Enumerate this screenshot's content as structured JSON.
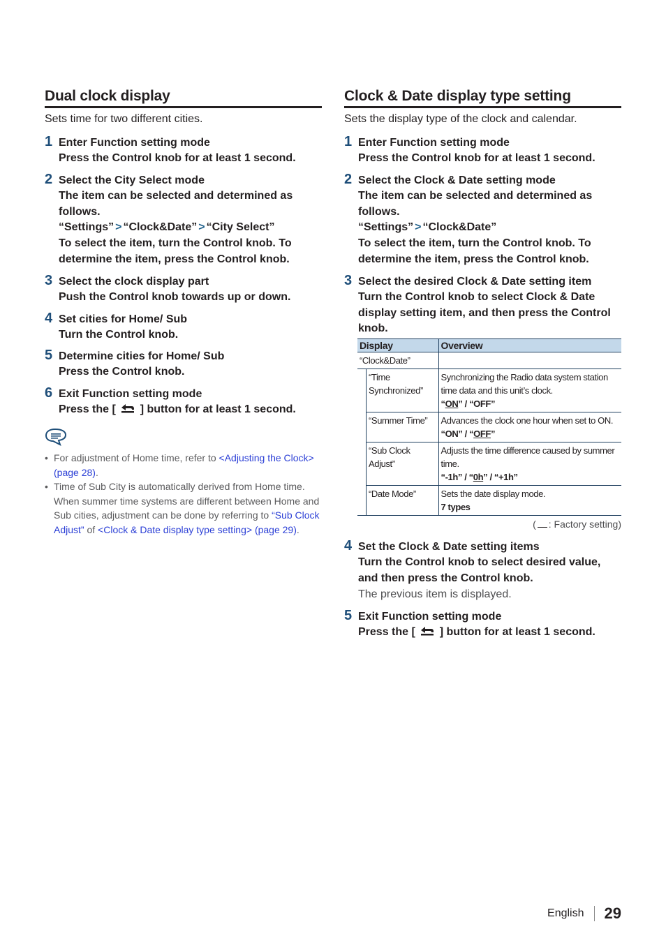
{
  "left": {
    "title": "Dual clock display",
    "intro": "Sets time for two different cities.",
    "steps": [
      {
        "num": "1",
        "title": "Enter Function setting mode",
        "body": "Press the Control knob for at least 1 second."
      },
      {
        "num": "2",
        "title": "Select the City Select mode",
        "body1": "The item can be selected and determined as follows.",
        "path": [
          "“Settings”",
          "“Clock&Date”",
          "“City Select”"
        ],
        "body2": "To select the item, turn the Control knob. To determine the item, press the Control knob."
      },
      {
        "num": "3",
        "title": "Select the clock display part",
        "body": "Push the Control knob towards up or down."
      },
      {
        "num": "4",
        "title": "Set cities for Home/ Sub",
        "body": "Turn the Control knob."
      },
      {
        "num": "5",
        "title": "Determine cities for Home/ Sub",
        "body": "Press the Control knob."
      },
      {
        "num": "6",
        "title": "Exit Function setting mode",
        "body_pre": "Press the [",
        "body_post": "] button for at least 1 second."
      }
    ],
    "notes": [
      {
        "text": "For adjustment of Home time, refer to ",
        "link": "<Adjusting the Clock> (page 28)",
        "tail": "."
      },
      {
        "text": "Time of Sub City is automatically derived from Home time. When summer time systems are different between Home and Sub cities, adjustment can be done by referring to ",
        "link1": "“Sub Clock Adjust”",
        "mid": " of ",
        "link2": "<Clock & Date display type setting> (page 29)",
        "tail": "."
      }
    ]
  },
  "right": {
    "title": "Clock & Date display type setting",
    "intro": "Sets the display type of the clock and calendar.",
    "steps": [
      {
        "num": "1",
        "title": "Enter Function setting mode",
        "body": "Press the Control knob for at least 1 second."
      },
      {
        "num": "2",
        "title": "Select the Clock & Date setting mode",
        "body1": "The item can be selected and determined as follows.",
        "path": [
          "“Settings”",
          "“Clock&Date”"
        ],
        "body2": "To select the item, turn the Control knob. To determine the item, press the Control knob."
      },
      {
        "num": "3",
        "title": "Select the desired Clock & Date setting item",
        "body": "Turn the Control knob to select Clock & Date display setting item, and then press the Control knob."
      },
      {
        "num": "4",
        "title": "Set the Clock & Date setting items",
        "body": "Turn the Control knob to select desired value, and then press the Control knob.",
        "sub": "The previous item is displayed."
      },
      {
        "num": "5",
        "title": "Exit Function setting mode",
        "body_pre": "Press the [",
        "body_post": "] button for at least 1 second."
      }
    ],
    "table": {
      "headers": [
        "Display",
        "Overview"
      ],
      "group": "“Clock&Date”",
      "rows": [
        {
          "display": "“Time Synchronized”",
          "overview": "Synchronizing the Radio data system station time data and this unit’s clock.",
          "options": [
            {
              "text": "“",
              "u": false
            },
            {
              "text": "ON",
              "u": true
            },
            {
              "text": "” / “OFF”",
              "u": false
            }
          ]
        },
        {
          "display": "“Summer Time”",
          "overview": "Advances the clock one hour when set to ON.",
          "options": [
            {
              "text": "“ON” / “",
              "u": false
            },
            {
              "text": "OFF",
              "u": true
            },
            {
              "text": "”",
              "u": false
            }
          ]
        },
        {
          "display": "“Sub Clock Adjust”",
          "overview": "Adjusts the time difference caused by summer time.",
          "options": [
            {
              "text": "“-1h” / “",
              "u": false
            },
            {
              "text": "0h",
              "u": true
            },
            {
              "text": "” / “+1h”",
              "u": false
            }
          ]
        },
        {
          "display": "“Date Mode”",
          "overview": "Sets the date display mode.",
          "options": [
            {
              "text": "7 types",
              "u": false
            }
          ]
        }
      ],
      "legend_pre": "(",
      "legend_post": ": Factory setting)"
    }
  },
  "footer": {
    "language": "English",
    "page": "29"
  },
  "colors": {
    "step_number": "#1e4e79",
    "link": "#2b3fd6",
    "table_header_bg": "#c3d8ea",
    "table_border": "#1e3e5e"
  }
}
